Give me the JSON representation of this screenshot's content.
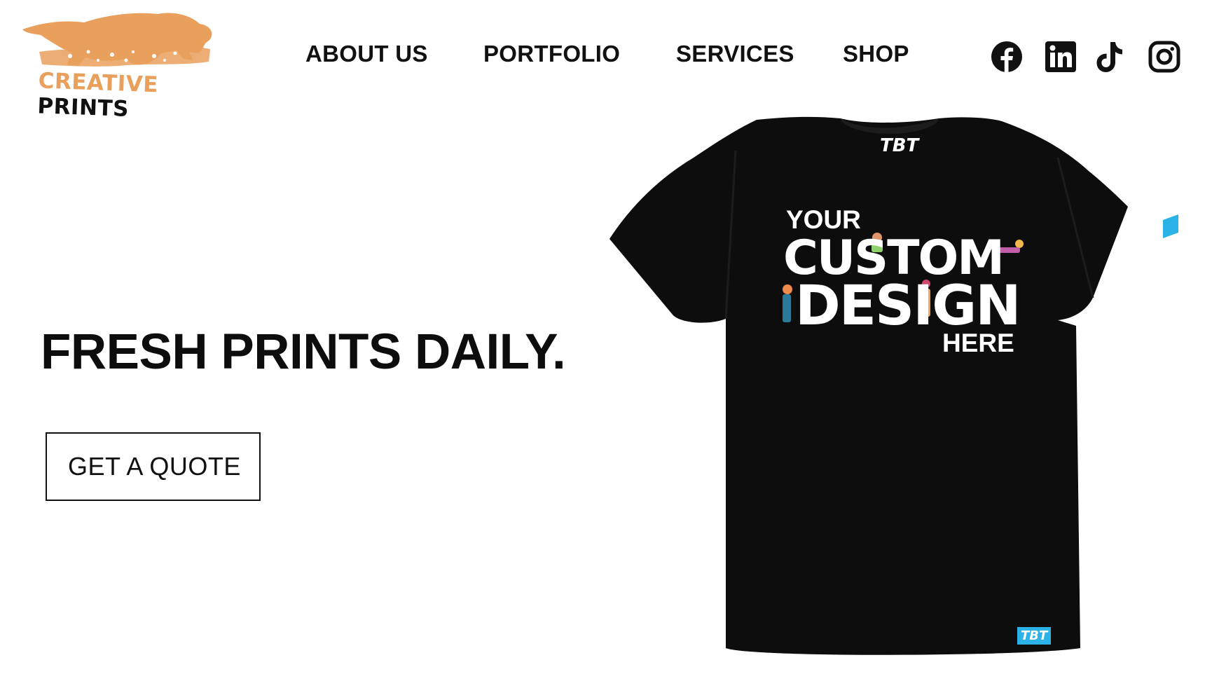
{
  "brand": {
    "logo_word1": "CREATIVE",
    "logo_word2": "PRINTS",
    "logo_color": "#e9a05c"
  },
  "nav": {
    "items": [
      {
        "label": "ABOUT US"
      },
      {
        "label": "PORTFOLIO"
      },
      {
        "label": "SERVICES"
      },
      {
        "label": "SHOP"
      }
    ]
  },
  "social": {
    "icons": [
      "facebook-icon",
      "linkedin-icon",
      "tiktok-icon",
      "instagram-icon"
    ]
  },
  "hero": {
    "headline": "FRESH PRINTS DAILY.",
    "cta_label": "GET A QUOTE"
  },
  "product": {
    "tee_brand": "TBT",
    "design_line1": "YOUR",
    "design_line2": "CUSTOM",
    "design_line3": "DESIGN",
    "design_line4": "HERE",
    "tag_label": "TBT",
    "tag_color": "#2bb3e8"
  }
}
